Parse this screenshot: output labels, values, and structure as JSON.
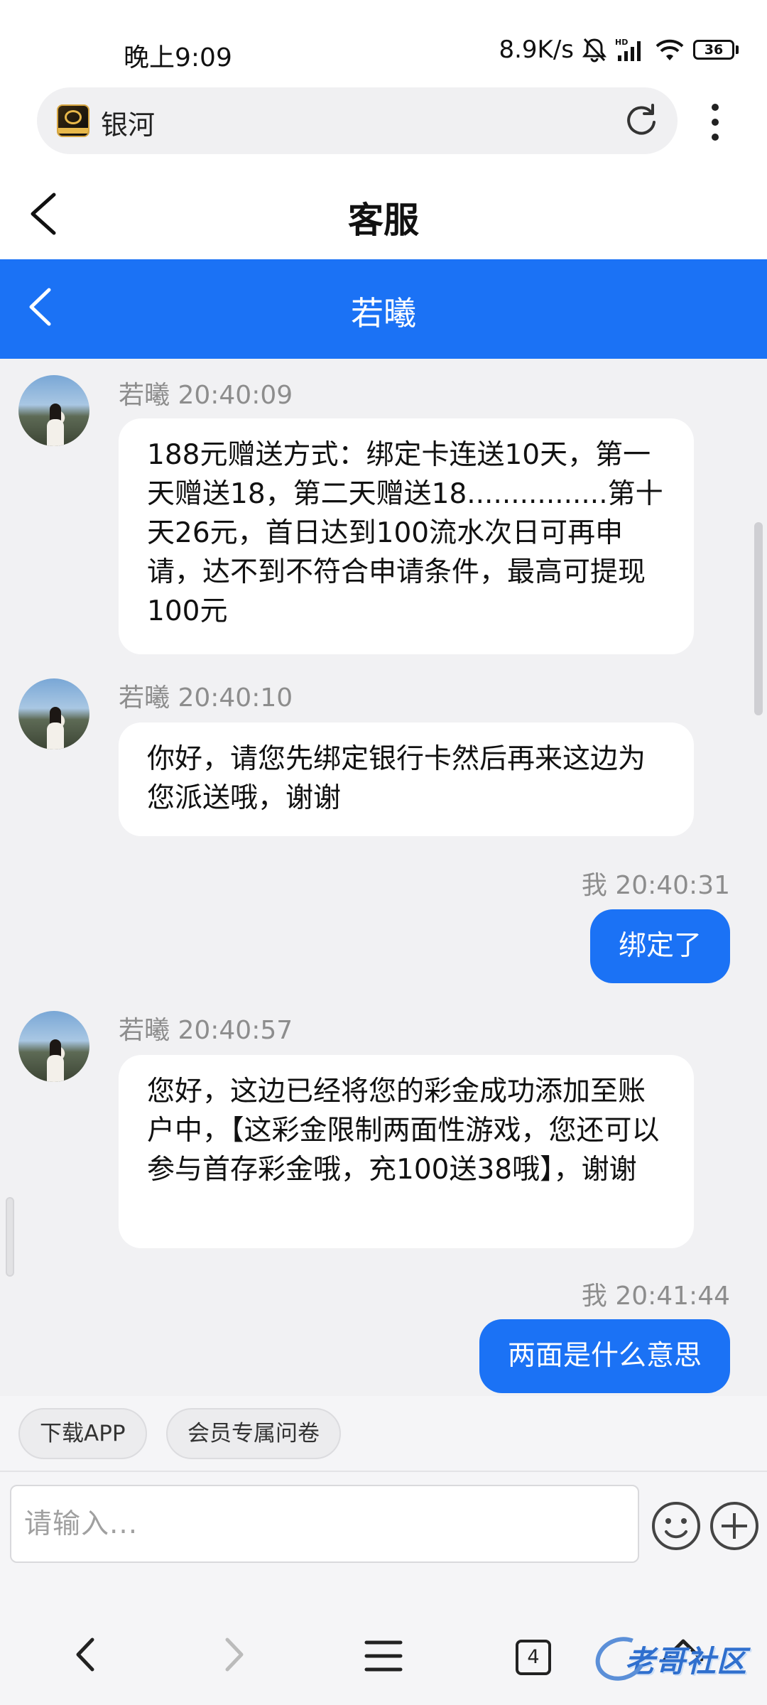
{
  "status_bar": {
    "time": "晚上9:09",
    "net_speed": "8.9K/s",
    "battery": "36"
  },
  "browser": {
    "site_title": "银河"
  },
  "page": {
    "title": "客服"
  },
  "chat": {
    "agent_name": "若曦",
    "messages": [
      {
        "sender": "若曦",
        "time": "20:40:09",
        "direction": "in",
        "text": "188元赠送方式：绑定卡连送10天，第一天赠送18，第二天赠送18................第十天26元，首日达到100流水次日可再申请，达不到不符合申请条件，最高可提现100元"
      },
      {
        "sender": "若曦",
        "time": "20:40:10",
        "direction": "in",
        "text": "你好，请您先绑定银行卡然后再来这边为您派送哦，谢谢"
      },
      {
        "sender": "我",
        "time": "20:40:31",
        "direction": "out",
        "text": "绑定了"
      },
      {
        "sender": "若曦",
        "time": "20:40:57",
        "direction": "in",
        "text": "您好，这边已经将您的彩金成功添加至账户中，【这彩金限制两面性游戏，您还可以参与首存彩金哦，充100送38哦】，谢谢"
      },
      {
        "sender": "我",
        "time": "20:41:44",
        "direction": "out",
        "text": "两面是什么意思"
      }
    ]
  },
  "quick_actions": [
    "下载APP",
    "会员专属问卷"
  ],
  "composer": {
    "placeholder": "请输入..."
  },
  "bottom_nav": {
    "tab_count": "4"
  },
  "watermark": {
    "text": "老哥社区"
  },
  "colors": {
    "accent": "#1b72f5",
    "chat_bg": "#f1f1f3",
    "meta_text": "#8d8d8d"
  }
}
